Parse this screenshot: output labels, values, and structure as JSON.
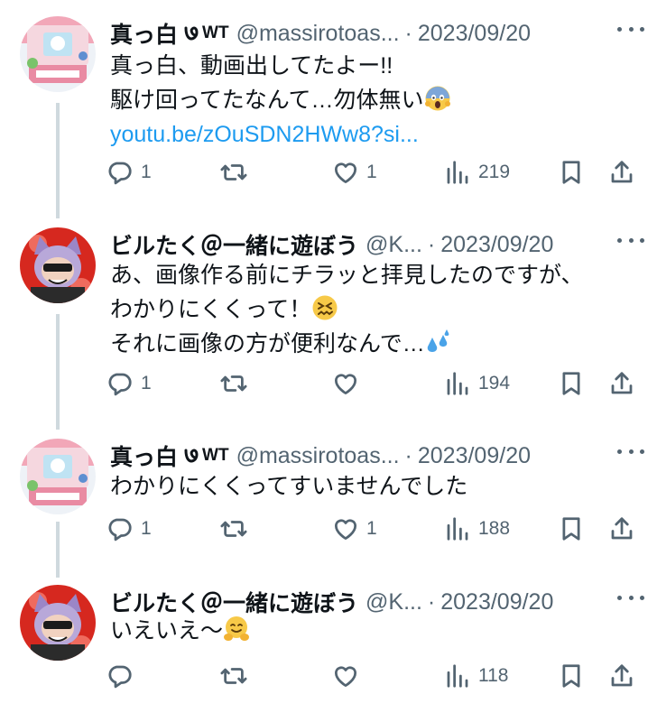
{
  "tweets": [
    {
      "name": "真っ白",
      "name_suffix": "WT",
      "handle": "@massirotoas...",
      "sep": "·",
      "date": "2023/09/20",
      "lines": [
        "真っ白、動画出してたよー!!",
        "駆け回ってたなんて…勿体無い"
      ],
      "link": "youtu.be/zOuSDN2HWw8?si...",
      "emoji": "scream-emoji",
      "replies": "1",
      "retweets": "",
      "likes": "1",
      "views": "219"
    },
    {
      "name": "ビルたく＠一緒に遊ぼう",
      "handle": "@K...",
      "sep": "·",
      "date": "2023/09/20",
      "lines": [
        "あ、画像作る前にチラッと拝見したのですが、",
        "わかりにくくって！",
        "それに画像の方が便利なんで…"
      ],
      "emoji": "confounded-emoji, sweat-droplets-emoji",
      "replies": "1",
      "retweets": "",
      "likes": "",
      "views": "194"
    },
    {
      "name": "真っ白",
      "name_suffix": "WT",
      "handle": "@massirotoas...",
      "sep": "·",
      "date": "2023/09/20",
      "lines": [
        "わかりにくくってすいませんでした"
      ],
      "replies": "1",
      "retweets": "",
      "likes": "1",
      "views": "188"
    },
    {
      "name": "ビルたく＠一緒に遊ぼう",
      "handle": "@K...",
      "sep": "·",
      "date": "2023/09/20",
      "lines": [
        "いえいえ〜"
      ],
      "emoji": "hugging-face-emoji",
      "replies": "",
      "retweets": "",
      "likes": "",
      "views": "118"
    }
  ],
  "colors": {
    "text": "#0f1419",
    "muted": "#536471",
    "link": "#1d9bf0",
    "thread_line": "#cfd9de"
  }
}
